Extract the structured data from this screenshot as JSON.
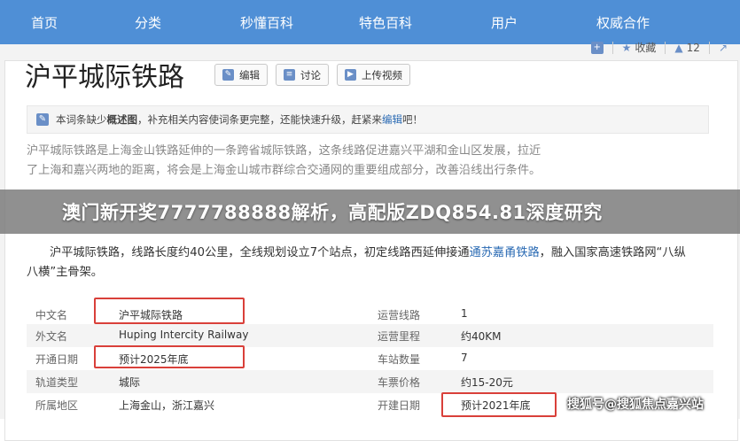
{
  "nav": [
    "首页",
    "分类",
    "秒懂百科",
    "特色百科",
    "用户",
    "权威合作"
  ],
  "actions": {
    "collect": "收藏",
    "like_count": "12"
  },
  "title": "沪平城际铁路",
  "buttons": {
    "edit": "编辑",
    "discuss": "讨论",
    "upload_video": "上传视频"
  },
  "notice": {
    "pre": "本词条缺少",
    "bold": "概述图",
    "mid": "，补充相关内容使词条更完整，还能快速升级，赶紧来",
    "link": "编辑",
    "post": "吧！"
  },
  "para_faded": {
    "line1": "沪平城际铁路是上海金山铁路延伸的一条跨省城际铁路，这条线路促进嘉兴平湖和金山区发展，拉近",
    "line2": "了上海和嘉兴两地的距离，将会是上海金山城市群综合交通网的重要组成部分，改善沿线出行条件。"
  },
  "banner": "澳门新开奖7777788888解析，高配版ZDQ854.81深度研究",
  "para": {
    "text1": "沪平城际铁路，线路长度约40公里，全线规划设立7个站点，初定线路西延伸接通",
    "link": "通苏嘉甬铁路",
    "text2": "，融入国家高速铁路网“八纵",
    "line2": "八横”主骨架。"
  },
  "info": [
    {
      "k1": "中文名",
      "v1": "沪平城际铁路",
      "k2": "运营线路",
      "v2": "1"
    },
    {
      "k1": "外文名",
      "v1": "Huping Intercity Railway",
      "k2": "运营里程",
      "v2": "约40KM"
    },
    {
      "k1": "开通日期",
      "v1": "预计2025年底",
      "k2": "车站数量",
      "v2": "7"
    },
    {
      "k1": "轨道类型",
      "v1": "城际",
      "k2": "车票价格",
      "v2": "约15-20元"
    },
    {
      "k1": "所属地区",
      "v1": "上海金山，浙江嘉兴",
      "k2": "开建日期",
      "v2": "预计2021年底"
    }
  ],
  "watermark": "搜狐号@搜狐焦点嘉兴站"
}
